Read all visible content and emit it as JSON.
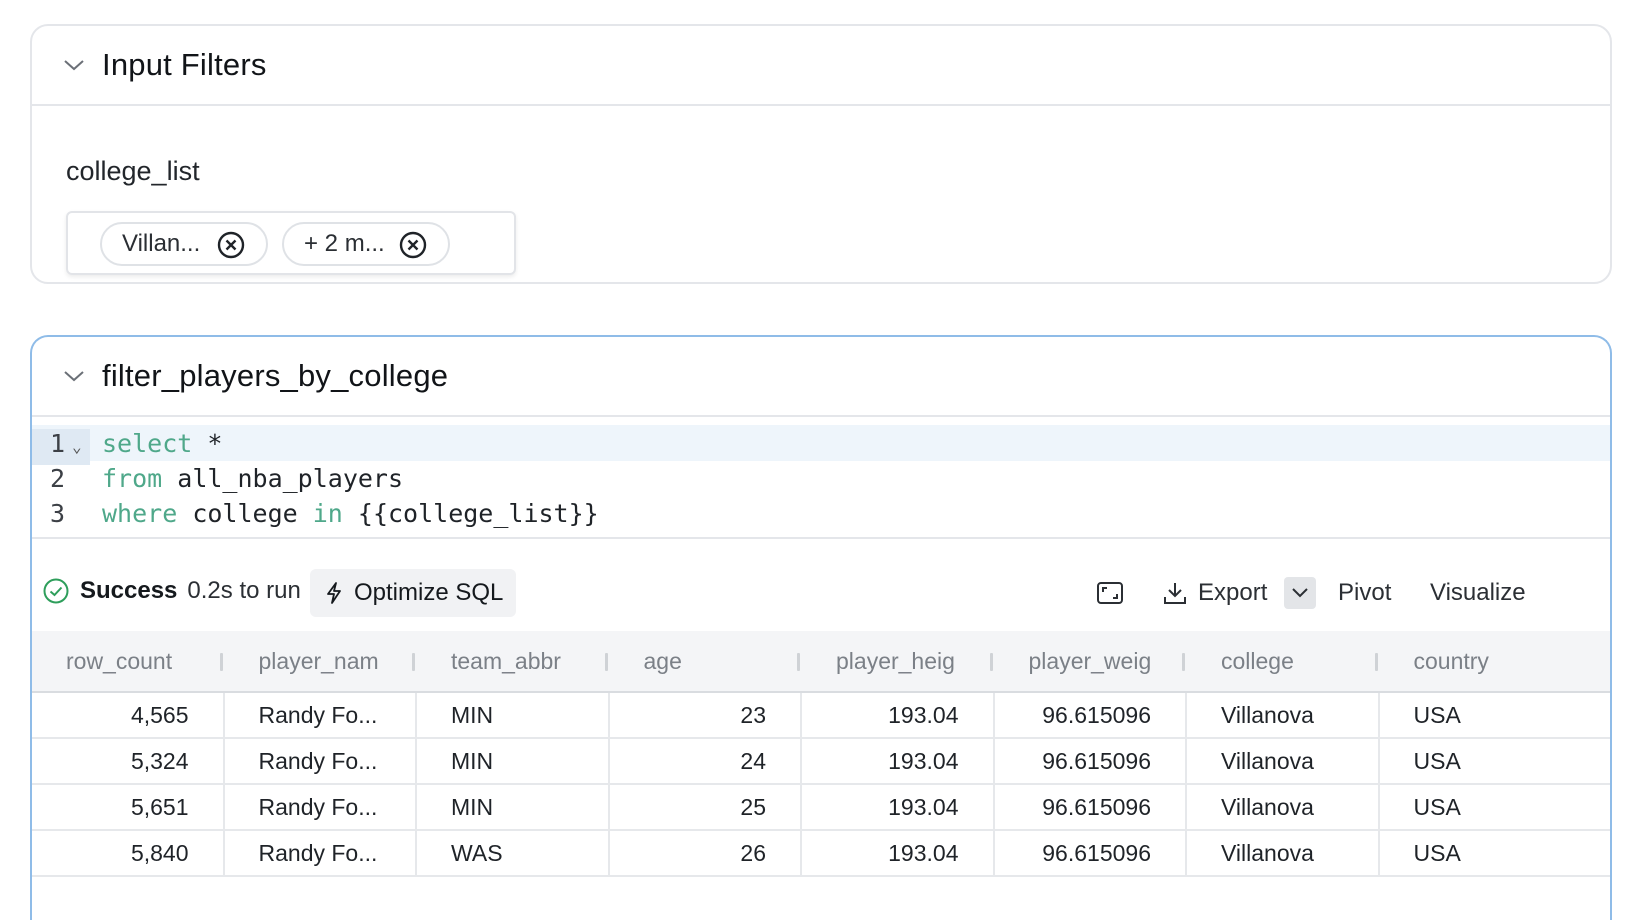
{
  "filters_card": {
    "title": "Input Filters",
    "filter_label": "college_list",
    "chips": [
      "Villan...",
      "+ 2 m..."
    ]
  },
  "cell": {
    "title": "filter_players_by_college",
    "code_lines": [
      {
        "num": "1",
        "parts": [
          {
            "t": "select",
            "kw": true
          },
          {
            "t": " *",
            "kw": false
          }
        ]
      },
      {
        "num": "2",
        "parts": [
          {
            "t": "from",
            "kw": true
          },
          {
            "t": " all_nba_players",
            "kw": false
          }
        ]
      },
      {
        "num": "3",
        "parts": [
          {
            "t": "where",
            "kw": true
          },
          {
            "t": " college ",
            "kw": false
          },
          {
            "t": "in",
            "kw": true
          },
          {
            "t": " {{college_list}}",
            "kw": false
          }
        ]
      }
    ],
    "status": {
      "label": "Success",
      "time": "0.2s to run"
    },
    "optimize_label": "Optimize SQL",
    "export_label": "Export",
    "pivot_label": "Pivot",
    "visualize_label": "Visualize"
  },
  "table": {
    "columns": [
      "row_count",
      "player_nam",
      "team_abbr",
      "age",
      "player_heig",
      "player_weig",
      "college",
      "country"
    ],
    "numeric": [
      true,
      false,
      false,
      true,
      true,
      true,
      false,
      false
    ],
    "rows": [
      [
        "4,565",
        "Randy Fo...",
        "MIN",
        "23",
        "193.04",
        "96.615096",
        "Villanova",
        "USA"
      ],
      [
        "5,324",
        "Randy Fo...",
        "MIN",
        "24",
        "193.04",
        "96.615096",
        "Villanova",
        "USA"
      ],
      [
        "5,651",
        "Randy Fo...",
        "MIN",
        "25",
        "193.04",
        "96.615096",
        "Villanova",
        "USA"
      ],
      [
        "5,840",
        "Randy Fo...",
        "WAS",
        "26",
        "193.04",
        "96.615096",
        "Villanova",
        "USA"
      ]
    ]
  },
  "colors": {
    "accent_border": "#8fbce8",
    "keyword": "#4fa88a",
    "success": "#2e9e5b"
  }
}
